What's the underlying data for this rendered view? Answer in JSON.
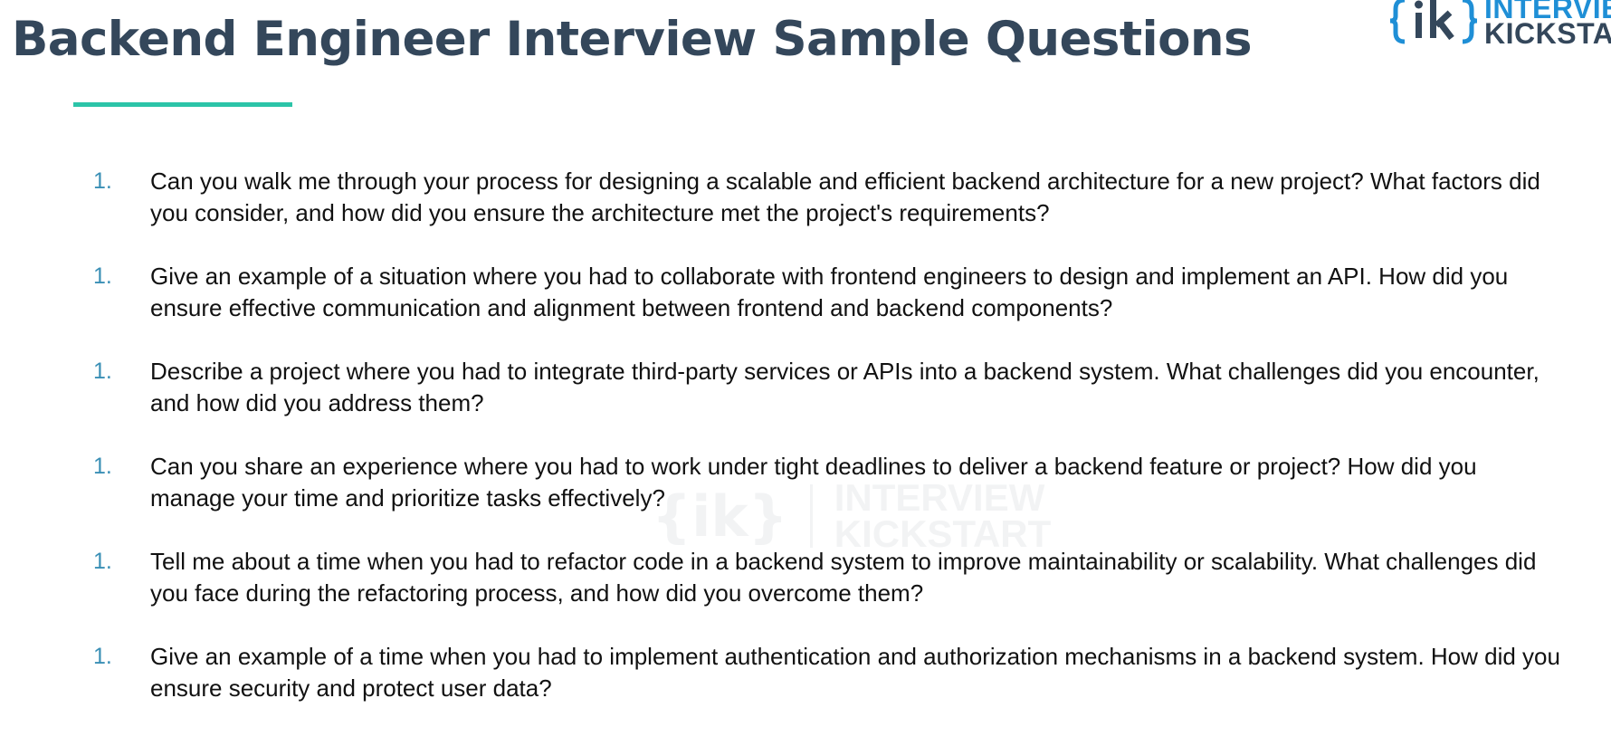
{
  "slide": {
    "title": "Backend Engineer Interview Sample Questions",
    "accent_color": "#2cc4a8",
    "title_color": "#34475b"
  },
  "logo": {
    "icon": "ik-brace-logo-icon",
    "line1": "INTERVIEW",
    "line2": "KICKSTART",
    "brand_color": "#1f8fd6"
  },
  "watermark": {
    "icon": "ik-brace-logo-icon",
    "mark": "{ik}",
    "line1": "INTERVIEW",
    "line2": "KICKSTART"
  },
  "questions": [
    {
      "number": "1.",
      "text": "Can you walk me through your process for designing a scalable and efficient backend architecture for a new project? What factors did you consider, and how did you ensure the architecture met the project's requirements?"
    },
    {
      "number": "1.",
      "text": "Give an example of a situation where you had to collaborate with frontend engineers to design and implement an API. How did you ensure effective communication and alignment between frontend and backend components?"
    },
    {
      "number": "1.",
      "text": "Describe a project where you had to integrate third-party services or APIs into a backend system. What challenges did you encounter, and how did you address them?"
    },
    {
      "number": "1.",
      "text": "Can you share an experience where you had to work under tight deadlines to deliver a backend feature or project? How did you manage your time and prioritize tasks effectively?"
    },
    {
      "number": "1.",
      "text": "Tell me about a time when you had to refactor code in a backend system to improve maintainability or scalability. What challenges did you face during the refactoring process, and how did you overcome them?"
    },
    {
      "number": "1.",
      "text": "Give an example of a time when you had to implement authentication and authorization mechanisms in a backend system. How did you ensure security and protect user data?"
    }
  ]
}
